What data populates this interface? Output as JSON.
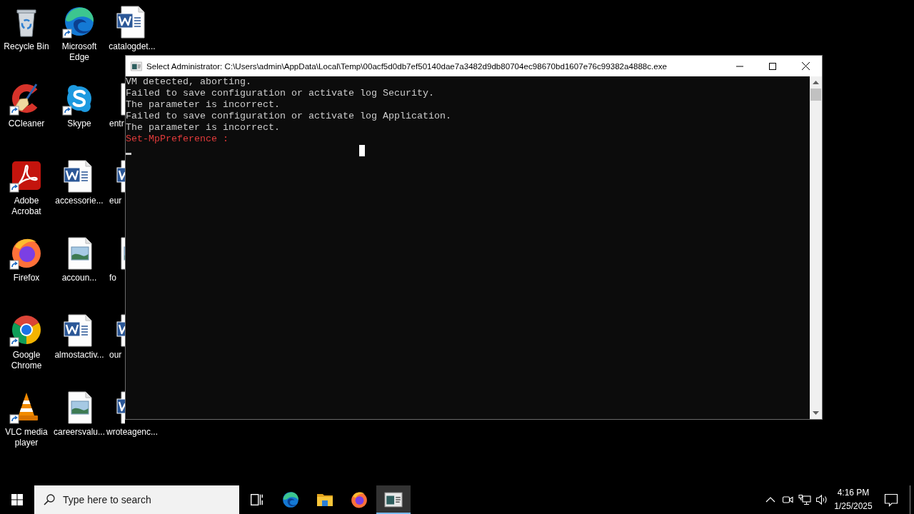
{
  "desktop": {
    "icons": [
      {
        "label": "Recycle Bin",
        "kind": "bin",
        "shortcut": false
      },
      {
        "label": "CCleaner",
        "kind": "ccleaner",
        "shortcut": true
      },
      {
        "label": "Adobe Acrobat",
        "kind": "acrobat",
        "shortcut": true
      },
      {
        "label": "Firefox",
        "kind": "firefox",
        "shortcut": true
      },
      {
        "label": "Google Chrome",
        "kind": "chrome",
        "shortcut": true
      },
      {
        "label": "VLC media player",
        "kind": "vlc",
        "shortcut": true
      },
      {
        "label": "Microsoft Edge",
        "kind": "edge",
        "shortcut": true
      },
      {
        "label": "Skype",
        "kind": "skype",
        "shortcut": true
      },
      {
        "label": "accessorie...",
        "kind": "word",
        "shortcut": false
      },
      {
        "label": "accoun...",
        "kind": "image",
        "shortcut": false
      },
      {
        "label": "almostactiv...",
        "kind": "word",
        "shortcut": false
      },
      {
        "label": "careersvalu...",
        "kind": "image",
        "shortcut": false
      },
      {
        "label": "catalogdet...",
        "kind": "word",
        "shortcut": false
      },
      {
        "label": "entr",
        "kind": "file",
        "shortcut": false
      },
      {
        "label": "eur",
        "kind": "word",
        "shortcut": false
      },
      {
        "label": "fo",
        "kind": "image",
        "shortcut": false
      },
      {
        "label": "our",
        "kind": "word",
        "shortcut": false
      },
      {
        "label": "wroteagenc...",
        "kind": "word",
        "shortcut": false
      }
    ]
  },
  "console": {
    "title": "Select Administrator: C:\\Users\\admin\\AppData\\Local\\Temp\\00acf5d0db7ef50140dae7a3482d9db80704ec98670bd1607e76c99382a4888c.exe",
    "lines": [
      {
        "text": "VM detected, aborting.",
        "kind": "output"
      },
      {
        "text": "Failed to save configuration or activate log Security.",
        "kind": "output"
      },
      {
        "text": "The parameter is incorrect.",
        "kind": "output"
      },
      {
        "text": "Failed to save configuration or activate log Application.",
        "kind": "output"
      },
      {
        "text": "The parameter is incorrect.",
        "kind": "output"
      },
      {
        "text": "Set-MpPreference :",
        "kind": "error"
      }
    ]
  },
  "taskbar": {
    "search": {
      "placeholder": "Type here to search"
    },
    "apps": [
      {
        "kind": "taskview",
        "selected": false
      },
      {
        "kind": "edge",
        "selected": false
      },
      {
        "kind": "explorer",
        "selected": false
      },
      {
        "kind": "firefox",
        "selected": false
      },
      {
        "kind": "console",
        "selected": true
      }
    ],
    "clock": {
      "time": "4:16 PM",
      "date": "1/25/2025"
    }
  }
}
